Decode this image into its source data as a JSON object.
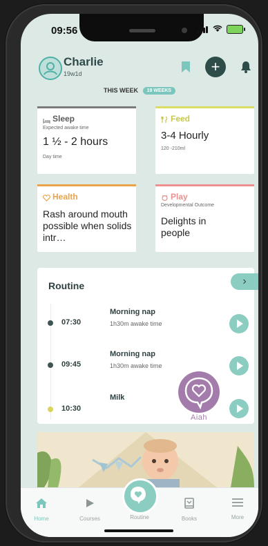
{
  "status": {
    "time": "09:56"
  },
  "header": {
    "child_name": "Charlie",
    "child_age": "19w1d"
  },
  "week": {
    "label": "THIS WEEK",
    "badge": "19 WEEKS"
  },
  "cards": {
    "sleep": {
      "title": "Sleep",
      "subtitle": "Expected awake time",
      "main": "1 ½ - 2 hours",
      "meta": "Day time",
      "color": "#7a7a7a"
    },
    "feed": {
      "title": "Feed",
      "main": "3-4 Hourly",
      "meta": "120 -210ml",
      "color": "#d9dd62"
    },
    "health": {
      "title": "Health",
      "main": "Rash around mouth possible when solids intr…",
      "color": "#e9a34a"
    },
    "play": {
      "title": "Play",
      "subtitle": "Developmental Outcome",
      "main": "Delights in people",
      "color": "#ef8f8f"
    }
  },
  "routine": {
    "title": "Routine",
    "items": [
      {
        "time": "07:30",
        "name": "Morning nap",
        "sub": "1h30m awake time",
        "dot_color": "#3f5553"
      },
      {
        "time": "09:45",
        "name": "Morning nap",
        "sub": "1h30m awake time",
        "dot_color": "#3f5553"
      },
      {
        "time": "10:30",
        "name": "Milk",
        "sub": "",
        "dot_color": "#d8d45c"
      }
    ],
    "assistant_label": "Aiah"
  },
  "tabs": [
    "Home",
    "Courses",
    "Routine",
    "Books",
    "More"
  ],
  "colors": {
    "accent": "#7cc7bd",
    "dark_teal": "#2e4d4a",
    "purple": "#a47cab",
    "background": "#dce9e5"
  }
}
